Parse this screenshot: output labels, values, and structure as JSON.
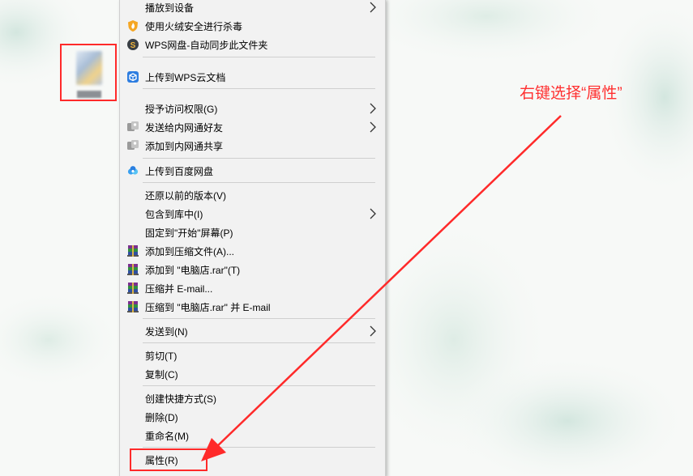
{
  "menu": {
    "items": [
      {
        "label": "播放到设备",
        "icon": "",
        "submenu": true
      },
      {
        "label": "使用火绒安全进行杀毒",
        "icon": "huorong-shield-icon",
        "submenu": false
      },
      {
        "label": "WPS网盘-自动同步此文件夹",
        "icon": "wps-sync-icon",
        "submenu": false
      },
      {
        "label": "上传到WPS云文档",
        "icon": "wps-cloud-icon",
        "submenu": false
      },
      {
        "label": "授予访问权限(G)",
        "icon": "",
        "submenu": true
      },
      {
        "label": "发送给内网通好友",
        "icon": "neiwangtong-icon",
        "submenu": true
      },
      {
        "label": "添加到内网通共享",
        "icon": "neiwangtong-icon",
        "submenu": false
      },
      {
        "label": "上传到百度网盘",
        "icon": "baidu-netdisk-icon",
        "submenu": false
      },
      {
        "label": "还原以前的版本(V)",
        "icon": "",
        "submenu": false
      },
      {
        "label": "包含到库中(I)",
        "icon": "",
        "submenu": true
      },
      {
        "label": "固定到\"开始\"屏幕(P)",
        "icon": "",
        "submenu": false
      },
      {
        "label": "添加到压缩文件(A)...",
        "icon": "winrar-icon",
        "submenu": false
      },
      {
        "label": "添加到 \"电脑店.rar\"(T)",
        "icon": "winrar-icon",
        "submenu": false
      },
      {
        "label": "压缩并 E-mail...",
        "icon": "winrar-icon",
        "submenu": false
      },
      {
        "label": "压缩到 \"电脑店.rar\" 并 E-mail",
        "icon": "winrar-icon",
        "submenu": false
      },
      {
        "label": "发送到(N)",
        "icon": "",
        "submenu": true
      },
      {
        "label": "剪切(T)",
        "icon": "",
        "submenu": false
      },
      {
        "label": "复制(C)",
        "icon": "",
        "submenu": false
      },
      {
        "label": "创建快捷方式(S)",
        "icon": "",
        "submenu": false
      },
      {
        "label": "删除(D)",
        "icon": "",
        "submenu": false
      },
      {
        "label": "重命名(M)",
        "icon": "",
        "submenu": false
      },
      {
        "label": "属性(R)",
        "icon": "",
        "submenu": false
      }
    ]
  },
  "annotation": {
    "text": "右键选择“属性”",
    "color": "#ff3030"
  }
}
